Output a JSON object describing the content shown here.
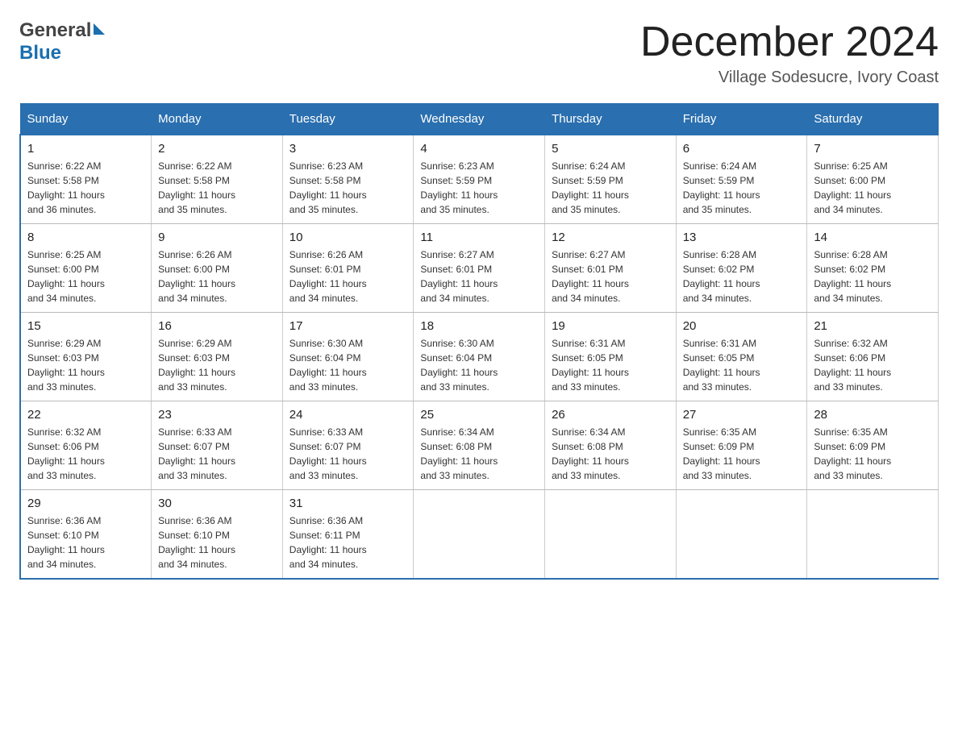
{
  "header": {
    "logo_general": "General",
    "logo_blue": "Blue",
    "month_title": "December 2024",
    "subtitle": "Village Sodesucre, Ivory Coast"
  },
  "days_of_week": [
    "Sunday",
    "Monday",
    "Tuesday",
    "Wednesday",
    "Thursday",
    "Friday",
    "Saturday"
  ],
  "weeks": [
    [
      {
        "day": "1",
        "sunrise": "6:22 AM",
        "sunset": "5:58 PM",
        "daylight": "11 hours and 36 minutes."
      },
      {
        "day": "2",
        "sunrise": "6:22 AM",
        "sunset": "5:58 PM",
        "daylight": "11 hours and 35 minutes."
      },
      {
        "day": "3",
        "sunrise": "6:23 AM",
        "sunset": "5:58 PM",
        "daylight": "11 hours and 35 minutes."
      },
      {
        "day": "4",
        "sunrise": "6:23 AM",
        "sunset": "5:59 PM",
        "daylight": "11 hours and 35 minutes."
      },
      {
        "day": "5",
        "sunrise": "6:24 AM",
        "sunset": "5:59 PM",
        "daylight": "11 hours and 35 minutes."
      },
      {
        "day": "6",
        "sunrise": "6:24 AM",
        "sunset": "5:59 PM",
        "daylight": "11 hours and 35 minutes."
      },
      {
        "day": "7",
        "sunrise": "6:25 AM",
        "sunset": "6:00 PM",
        "daylight": "11 hours and 34 minutes."
      }
    ],
    [
      {
        "day": "8",
        "sunrise": "6:25 AM",
        "sunset": "6:00 PM",
        "daylight": "11 hours and 34 minutes."
      },
      {
        "day": "9",
        "sunrise": "6:26 AM",
        "sunset": "6:00 PM",
        "daylight": "11 hours and 34 minutes."
      },
      {
        "day": "10",
        "sunrise": "6:26 AM",
        "sunset": "6:01 PM",
        "daylight": "11 hours and 34 minutes."
      },
      {
        "day": "11",
        "sunrise": "6:27 AM",
        "sunset": "6:01 PM",
        "daylight": "11 hours and 34 minutes."
      },
      {
        "day": "12",
        "sunrise": "6:27 AM",
        "sunset": "6:01 PM",
        "daylight": "11 hours and 34 minutes."
      },
      {
        "day": "13",
        "sunrise": "6:28 AM",
        "sunset": "6:02 PM",
        "daylight": "11 hours and 34 minutes."
      },
      {
        "day": "14",
        "sunrise": "6:28 AM",
        "sunset": "6:02 PM",
        "daylight": "11 hours and 34 minutes."
      }
    ],
    [
      {
        "day": "15",
        "sunrise": "6:29 AM",
        "sunset": "6:03 PM",
        "daylight": "11 hours and 33 minutes."
      },
      {
        "day": "16",
        "sunrise": "6:29 AM",
        "sunset": "6:03 PM",
        "daylight": "11 hours and 33 minutes."
      },
      {
        "day": "17",
        "sunrise": "6:30 AM",
        "sunset": "6:04 PM",
        "daylight": "11 hours and 33 minutes."
      },
      {
        "day": "18",
        "sunrise": "6:30 AM",
        "sunset": "6:04 PM",
        "daylight": "11 hours and 33 minutes."
      },
      {
        "day": "19",
        "sunrise": "6:31 AM",
        "sunset": "6:05 PM",
        "daylight": "11 hours and 33 minutes."
      },
      {
        "day": "20",
        "sunrise": "6:31 AM",
        "sunset": "6:05 PM",
        "daylight": "11 hours and 33 minutes."
      },
      {
        "day": "21",
        "sunrise": "6:32 AM",
        "sunset": "6:06 PM",
        "daylight": "11 hours and 33 minutes."
      }
    ],
    [
      {
        "day": "22",
        "sunrise": "6:32 AM",
        "sunset": "6:06 PM",
        "daylight": "11 hours and 33 minutes."
      },
      {
        "day": "23",
        "sunrise": "6:33 AM",
        "sunset": "6:07 PM",
        "daylight": "11 hours and 33 minutes."
      },
      {
        "day": "24",
        "sunrise": "6:33 AM",
        "sunset": "6:07 PM",
        "daylight": "11 hours and 33 minutes."
      },
      {
        "day": "25",
        "sunrise": "6:34 AM",
        "sunset": "6:08 PM",
        "daylight": "11 hours and 33 minutes."
      },
      {
        "day": "26",
        "sunrise": "6:34 AM",
        "sunset": "6:08 PM",
        "daylight": "11 hours and 33 minutes."
      },
      {
        "day": "27",
        "sunrise": "6:35 AM",
        "sunset": "6:09 PM",
        "daylight": "11 hours and 33 minutes."
      },
      {
        "day": "28",
        "sunrise": "6:35 AM",
        "sunset": "6:09 PM",
        "daylight": "11 hours and 33 minutes."
      }
    ],
    [
      {
        "day": "29",
        "sunrise": "6:36 AM",
        "sunset": "6:10 PM",
        "daylight": "11 hours and 34 minutes."
      },
      {
        "day": "30",
        "sunrise": "6:36 AM",
        "sunset": "6:10 PM",
        "daylight": "11 hours and 34 minutes."
      },
      {
        "day": "31",
        "sunrise": "6:36 AM",
        "sunset": "6:11 PM",
        "daylight": "11 hours and 34 minutes."
      },
      null,
      null,
      null,
      null
    ]
  ],
  "labels": {
    "sunrise": "Sunrise:",
    "sunset": "Sunset:",
    "daylight": "Daylight:"
  }
}
